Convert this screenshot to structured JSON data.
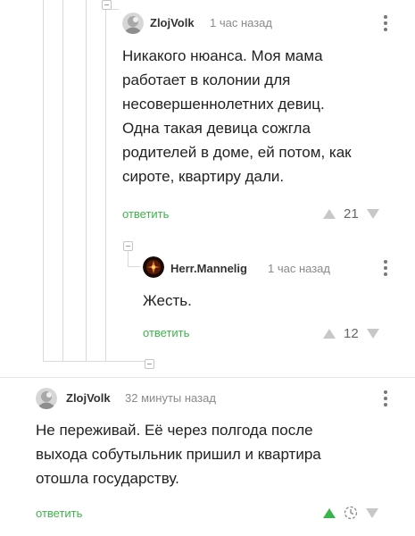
{
  "comments": [
    {
      "user": "ZlojVolk",
      "time": "1 час назад",
      "lines": [
        "Никакого нюанса. Моя мама",
        "работает в колонии для",
        "несовершеннолетних девиц.",
        "Одна такая девица сожгла",
        "родителей в доме, ей потом, как",
        "сироте, квартиру дали."
      ],
      "reply": "ответить",
      "rating": "21"
    },
    {
      "user": "Herr.Mannelig",
      "time": "1 час назад",
      "lines": [
        "Жесть."
      ],
      "reply": "ответить",
      "rating": "12"
    },
    {
      "user": "ZlojVolk",
      "time": "32 минуты назад",
      "lines": [
        "Не переживай. Её через полгода после",
        "выхода собутыльник пришил и квартира",
        "отошла государству."
      ],
      "reply": "ответить",
      "rating_icon": "clock-icon"
    }
  ],
  "colors": {
    "accent": "#3bb54a",
    "muted": "#8a8a8a",
    "thread": "#d9d9d9"
  }
}
